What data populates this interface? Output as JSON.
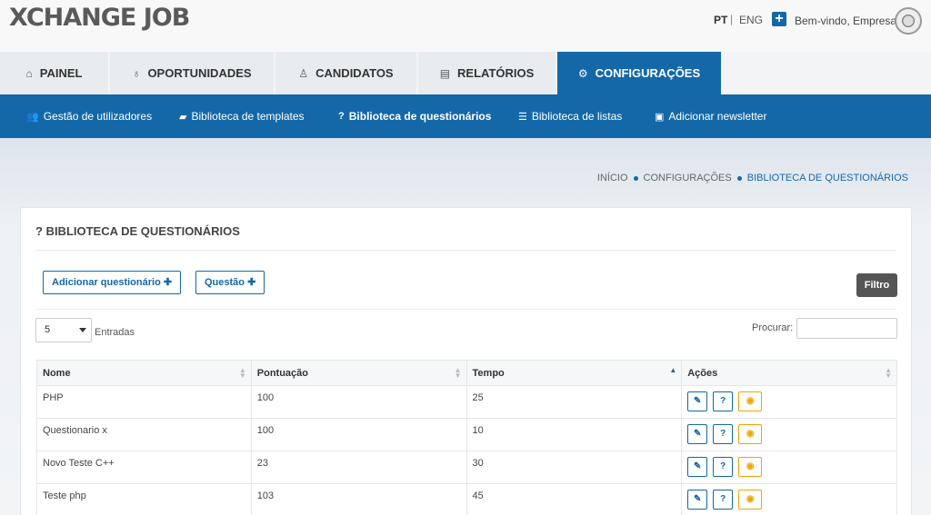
{
  "header": {
    "logo": "XCHANGE JOB",
    "lang_pt": "PT",
    "lang_sep": "|",
    "lang_eng": "ENG",
    "plus": "+",
    "welcome": "Bem-vindo, Empresa"
  },
  "tabs": [
    {
      "label": "PAINEL",
      "icon": "home-icon"
    },
    {
      "label": "OPORTUNIDADES",
      "icon": "lightbulb-icon"
    },
    {
      "label": "CANDIDATOS",
      "icon": "user-icon"
    },
    {
      "label": "RELATÓRIOS",
      "icon": "document-icon"
    },
    {
      "label": "CONFIGURAÇÕES",
      "icon": "cogs-icon",
      "active": true
    }
  ],
  "subnav": [
    {
      "label": "Gestão de utilizadores",
      "icon": "users-icon"
    },
    {
      "label": "Biblioteca de templates",
      "icon": "book-icon"
    },
    {
      "label": "Biblioteca de questionários",
      "icon": "question-icon",
      "active": true
    },
    {
      "label": "Biblioteca de listas",
      "icon": "list-icon"
    },
    {
      "label": "Adicionar newsletter",
      "icon": "newspaper-icon"
    }
  ],
  "breadcrumb": [
    "INÍCIO",
    "CONFIGURAÇÕES",
    "BIBLIOTECA DE QUESTIONÁRIOS"
  ],
  "card": {
    "title": "? BIBLIOTECA DE QUESTIONÁRIOS",
    "add_button": "Adicionar questionário ✚",
    "question_button": "Questão ✚",
    "filter_button": "Filtro",
    "entries_value": "5",
    "entries_label": "Entradas",
    "search_label": "Procurar:"
  },
  "table": {
    "headers": [
      "Nome",
      "Pontuação",
      "Tempo",
      "Ações"
    ],
    "rows": [
      [
        "PHP",
        "100",
        "25"
      ],
      [
        "Questionario x",
        "100",
        "10"
      ],
      [
        "Novo Teste C++",
        "23",
        "30"
      ],
      [
        "Teste php",
        "103",
        "45"
      ]
    ]
  },
  "colors": {
    "brand_blue": "#1468a8",
    "view_orange": "#f0a500",
    "filter_gray": "#555555"
  }
}
